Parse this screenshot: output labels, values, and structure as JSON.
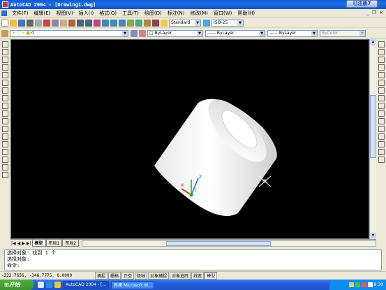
{
  "window": {
    "title": "AutoCAD 2004 - [Drawing1.dwg]",
    "ime_badge": "已注册7"
  },
  "menu": {
    "items": [
      "文件(F)",
      "编辑(E)",
      "视图(V)",
      "插入(I)",
      "格式(O)",
      "工具(T)",
      "绘图(D)",
      "标注(N)",
      "修改(M)",
      "窗口(W)",
      "帮助(H)"
    ],
    "win_controls": [
      "_",
      "❐",
      "×"
    ]
  },
  "toolbar": {
    "text_style": "Standard",
    "dim_style": "ISO-25",
    "layer": "0",
    "color": "ByLayer",
    "linetype": "ByLayer",
    "lineweight": "ByLayer",
    "plotstyle": "ByColor"
  },
  "ucs": {
    "x": "X",
    "y": "Y",
    "z": "Z"
  },
  "layout_tabs": [
    "模型",
    "布局1",
    "布局2"
  ],
  "command": {
    "lines": [
      "选择对象: 找到 1 个",
      "选择对象:",
      "命令:"
    ]
  },
  "status": {
    "coords": "-222.7656, -346.7775, 0.0000",
    "buttons": [
      "捕捉",
      "栅格",
      "正交",
      "极轴",
      "对象捕捉",
      "对象追踪",
      "线宽",
      "模型"
    ]
  },
  "taskbar": {
    "start": "开始",
    "tasks": [
      "AutoCAD 2004 - [...",
      "新建 Microsoft W..."
    ],
    "clock": "8:30"
  },
  "colors": {
    "canvas": "#000000",
    "taskbar": "#245edb",
    "start_button": "#3c962e"
  }
}
